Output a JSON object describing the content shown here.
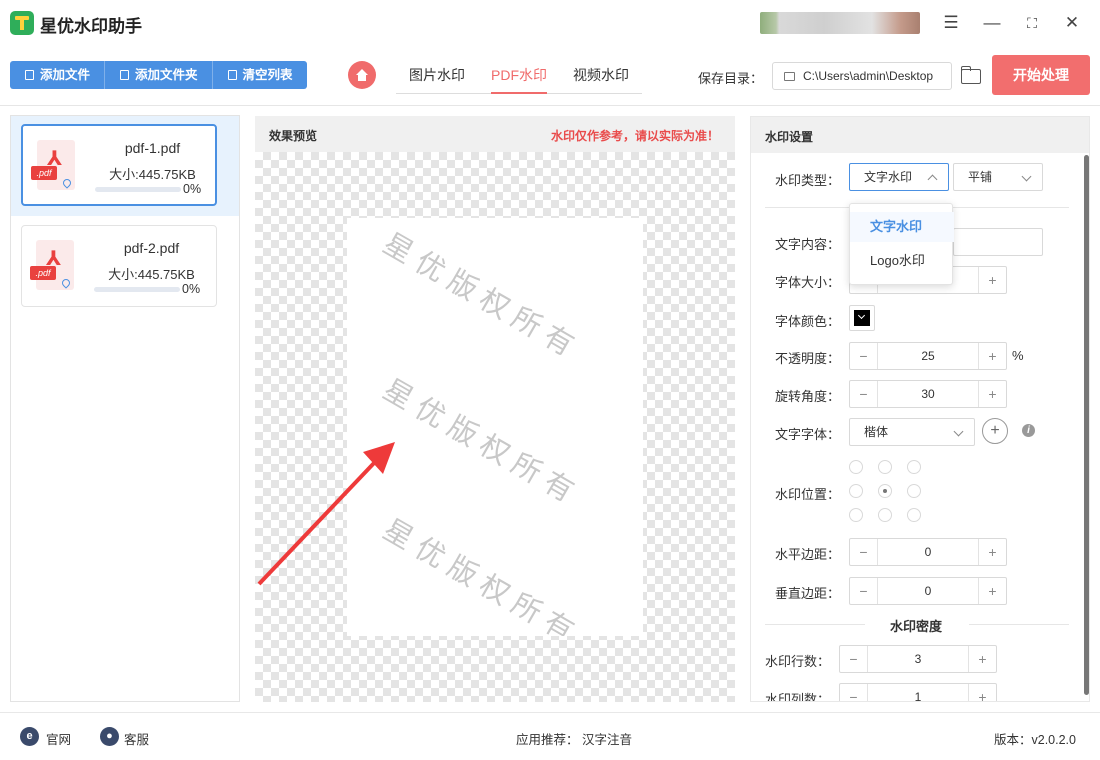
{
  "app": {
    "title": "星优水印助手"
  },
  "toolbar": {
    "add_file": "添加文件",
    "add_folder": "添加文件夹",
    "clear_list": "清空列表",
    "tabs": [
      "图片水印",
      "PDF水印",
      "视频水印"
    ],
    "active_tab": "PDF水印",
    "save_label": "保存目录：",
    "save_path": "C:\\Users\\admin\\Desktop",
    "start": "开始处理"
  },
  "files": [
    {
      "name": "pdf-1.pdf",
      "size": "大小:445.75KB",
      "progress": "0%",
      "selected": true
    },
    {
      "name": "pdf-2.pdf",
      "size": "大小:445.75KB",
      "progress": "0%",
      "selected": false
    }
  ],
  "preview": {
    "title": "效果预览",
    "note": "水印仅作参考，请以实际为准！",
    "watermark_text": "星优版权所有"
  },
  "settings": {
    "title": "水印设置",
    "type_label": "水印类型：",
    "type_value": "文字水印",
    "layout_value": "平铺",
    "dropdown": [
      "文字水印",
      "Logo水印"
    ],
    "content_label": "文字内容：",
    "size_label": "字体大小：",
    "color_label": "字体颜色：",
    "opacity_label": "不透明度：",
    "opacity_value": "25",
    "opacity_unit": "%",
    "rotation_label": "旋转角度：",
    "rotation_value": "30",
    "font_label": "文字字体：",
    "font_value": "楷体",
    "position_label": "水印位置：",
    "h_margin_label": "水平边距：",
    "h_margin_value": "0",
    "v_margin_label": "垂直边距：",
    "v_margin_value": "0",
    "density_title": "水印密度",
    "rows_label": "水印行数：",
    "rows_value": "3",
    "cols_label": "水印列数：",
    "cols_value": "1"
  },
  "footer": {
    "official": "官网",
    "support": "客服",
    "recommend_label": "应用推荐：",
    "recommend_value": "汉字注音",
    "version": "版本：v2.0.2.0"
  },
  "colors": {
    "accent": "#4a90e2",
    "brand_red": "#f26e6e"
  }
}
